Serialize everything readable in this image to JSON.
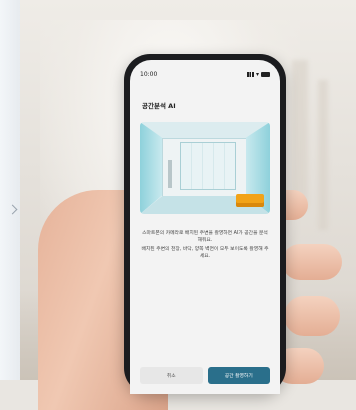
{
  "phone": {
    "status_time": "10:00",
    "title": "공간분석 AI",
    "description_1": "스마트폰의 카메라로 배치된 주변을 촬영하면 AI가 공간을 분석해줘요.",
    "description_2": "배치된 주변의 천장, 바닥, 양쪽 벽면이 모두 보이도록 촬영해 주세요.",
    "cancel_label": "취소",
    "start_label": "공간 촬영하기"
  },
  "colors": {
    "accent": "#2a6f8b",
    "sofa": "#f2a318",
    "wall_highlight": "#8ed1db"
  },
  "icons": [
    "signal-icon",
    "wifi-icon",
    "battery-icon",
    "chevron-right-icon"
  ]
}
